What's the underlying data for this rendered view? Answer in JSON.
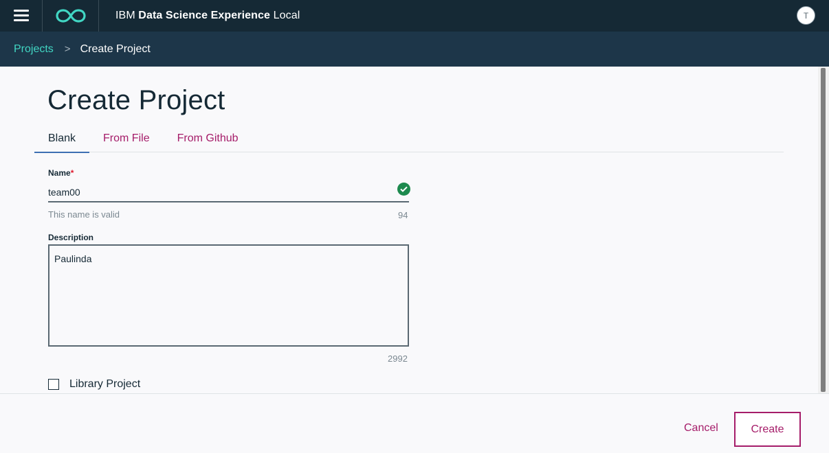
{
  "header": {
    "brand_prefix": "IBM",
    "brand_bold": "Data Science Experience",
    "brand_suffix": "Local",
    "avatar_initial": "T",
    "menu_icon": "hamburger-icon",
    "logo_icon": "infinity-logo-icon"
  },
  "breadcrumb": {
    "parent": "Projects",
    "separator": ">",
    "current": "Create Project"
  },
  "page": {
    "title": "Create Project"
  },
  "tabs": [
    {
      "label": "Blank",
      "active": true
    },
    {
      "label": "From File",
      "active": false
    },
    {
      "label": "From Github",
      "active": false
    }
  ],
  "form": {
    "name": {
      "label": "Name",
      "required_marker": "*",
      "value": "team00",
      "helper": "This name is valid",
      "remaining": "94",
      "status_icon": "check-circle-icon"
    },
    "description": {
      "label": "Description",
      "value": "Paulinda",
      "remaining": "2992"
    },
    "library_project": {
      "label": "Library Project",
      "checked": false
    }
  },
  "footer": {
    "cancel_label": "Cancel",
    "create_label": "Create"
  },
  "colors": {
    "topbar": "#152935",
    "breadcrumb_bar": "#1d3649",
    "accent_teal": "#41d6c3",
    "accent_magenta": "#a51c69",
    "success_green": "#1d8a4e"
  }
}
